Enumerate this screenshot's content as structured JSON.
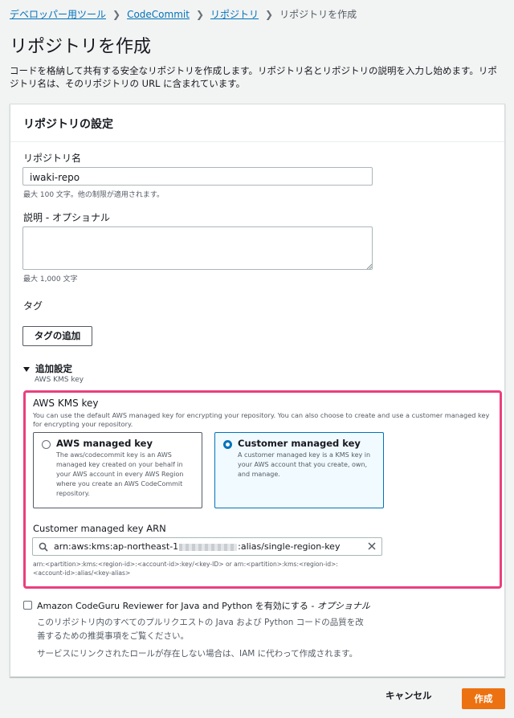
{
  "breadcrumb": {
    "items": [
      "デベロッパー用ツール",
      "CodeCommit",
      "リポジトリ"
    ],
    "current": "リポジトリを作成"
  },
  "page": {
    "title": "リポジトリを作成",
    "intro": "コードを格納して共有する安全なリポジトリを作成します。リポジトリ名とリポジトリの説明を入力し始めます。リポジトリ名は、そのリポジトリの URL に含まれています。"
  },
  "settings": {
    "header": "リポジトリの設定",
    "repo_name_label": "リポジトリ名",
    "repo_name_value": "iwaki-repo",
    "repo_name_hint": "最大 100 文字。他の制限が適用されます。",
    "desc_label": "説明 - オプショナル",
    "desc_value": "",
    "desc_hint": "最大 1,000 文字",
    "tags_label": "タグ",
    "add_tag_button": "タグの追加",
    "additional_label": "追加設定",
    "additional_sub": "AWS KMS key"
  },
  "kms": {
    "title": "AWS KMS key",
    "description": "You can use the default AWS managed key for encrypting your repository. You can also choose to create and use a customer managed key for encrypting your repository.",
    "options": [
      {
        "title": "AWS managed key",
        "desc": "The aws/codecommit key is an AWS managed key created on your behalf in your AWS account in every AWS Region where you create an AWS CodeCommit repository.",
        "selected": false
      },
      {
        "title": "Customer managed key",
        "desc": "A customer managed key is a KMS key in your AWS account that you create, own, and manage.",
        "selected": true
      }
    ],
    "arn_label": "Customer managed key ARN",
    "arn_prefix": "arn:aws:kms:ap-northeast-1",
    "arn_suffix": ":alias/single-region-key",
    "arn_hint_1": "arn:<partition>:kms:<region-id>:<account-id>:key/<key-ID> or arn:<partition>:kms:<region-id>:",
    "arn_hint_2": "<account-id>:alias/<key-alias>"
  },
  "codeguru": {
    "label_main": "Amazon CodeGuru Reviewer for Java and Python を有効にする",
    "label_optional": " - オプショナル",
    "checked": false,
    "desc_1": "このリポジトリ内のすべてのプルリクエストの Java および Python コードの品質を改",
    "desc_2": "善するための推奨事項をご覧ください。",
    "desc_3": "サービスにリンクされたロールが存在しない場合は、IAM に代わって作成されます。"
  },
  "footer": {
    "cancel": "キャンセル",
    "create": "作成"
  },
  "colors": {
    "link": "#0073bb",
    "primary": "#ec7211",
    "highlight": "#ea3f7e"
  }
}
